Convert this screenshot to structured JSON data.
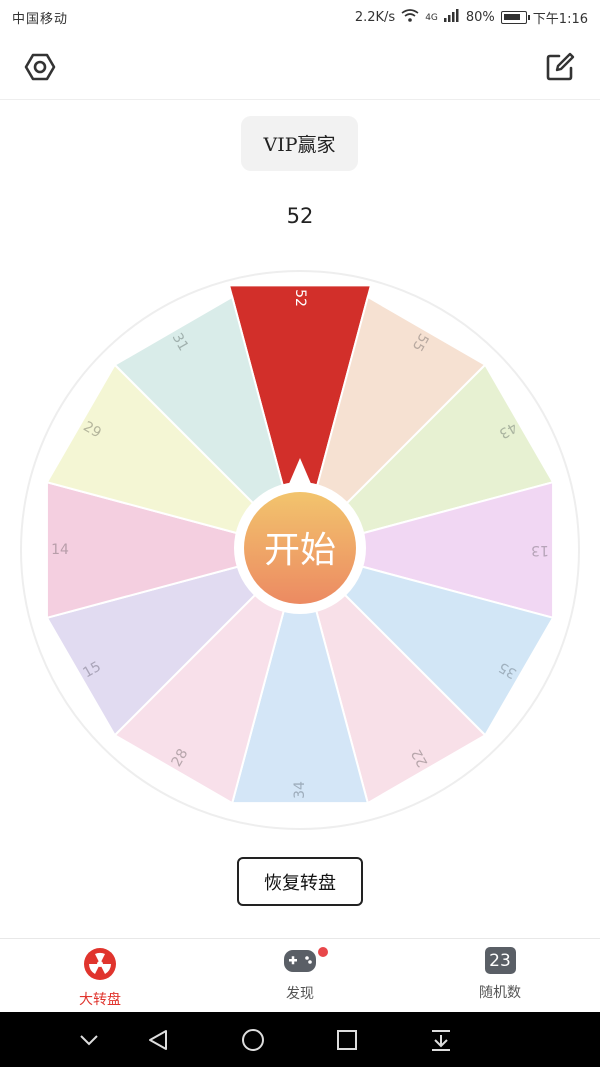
{
  "status_bar": {
    "carrier": "中国移动",
    "speed": "2.2K/s",
    "network": "4G",
    "battery": "80%",
    "time": "下午1:16"
  },
  "title": "VIP赢家",
  "result": "52",
  "wheel": {
    "start_label": "开始",
    "segments": [
      {
        "label": "52",
        "color": "#d22f2a",
        "text_color": "#ffffff"
      },
      {
        "label": "55",
        "color": "#f6e1d2",
        "text_color": "#b8a9a0"
      },
      {
        "label": "43",
        "color": "#e7f1d2",
        "text_color": "#aab4a0"
      },
      {
        "label": "13",
        "color": "#f1d7f3",
        "text_color": "#b6a4b8"
      },
      {
        "label": "35",
        "color": "#d2e6f6",
        "text_color": "#9fb0be"
      },
      {
        "label": "22",
        "color": "#f8e0e8",
        "text_color": "#b7a6ab"
      },
      {
        "label": "34",
        "color": "#d4e6f7",
        "text_color": "#9eadbc"
      },
      {
        "label": "28",
        "color": "#f8e0ea",
        "text_color": "#b7a6ac"
      },
      {
        "label": "15",
        "color": "#e1dbf1",
        "text_color": "#a9a4b8"
      },
      {
        "label": "14",
        "color": "#f4cfe0",
        "text_color": "#b89eaa"
      },
      {
        "label": "29",
        "color": "#f4f6d4",
        "text_color": "#b4b59c"
      },
      {
        "label": "31",
        "color": "#d9ece9",
        "text_color": "#a0b0ad"
      }
    ],
    "selected_index": 0
  },
  "reset_label": "恢复转盘",
  "bottom_nav": [
    {
      "label": "大转盘",
      "active": true
    },
    {
      "label": "发现",
      "active": false
    },
    {
      "label": "随机数",
      "active": false,
      "icon_text": "23"
    }
  ],
  "colors": {
    "accent": "#e0342d",
    "start_top": "#f2c46d",
    "start_bottom": "#ec8a62"
  }
}
